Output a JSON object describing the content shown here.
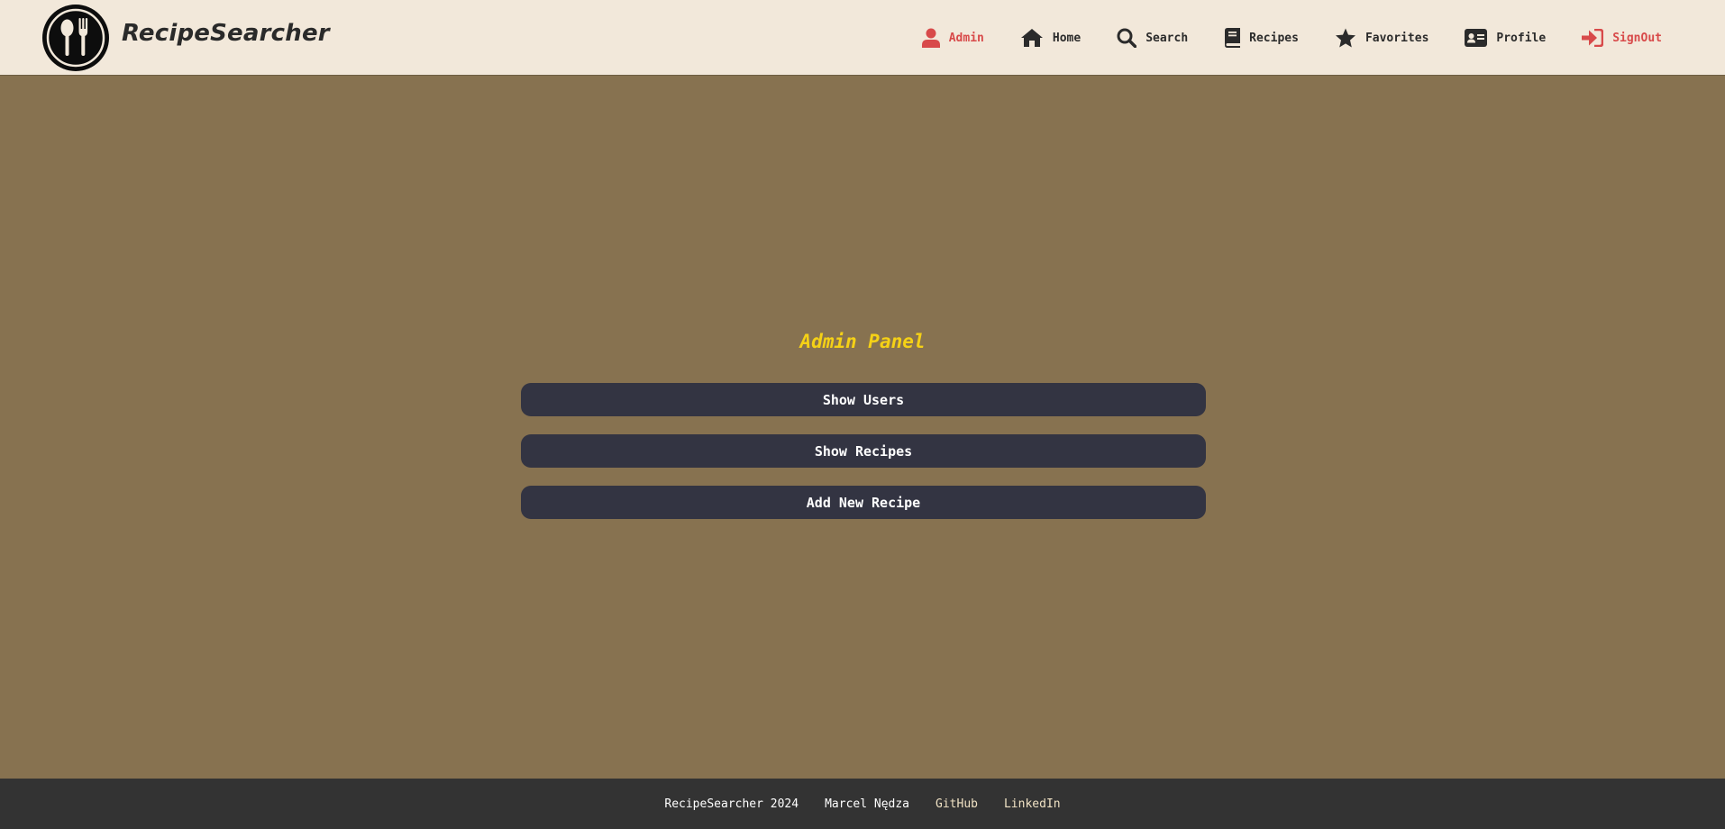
{
  "header": {
    "brand": "RecipeSearcher",
    "logo_icon": "spoon-fork-icon",
    "nav": [
      {
        "label": "Admin",
        "icon": "user-icon",
        "color": "#d84a4a"
      },
      {
        "label": "Home",
        "icon": "home-icon",
        "color": "#2b2b2b"
      },
      {
        "label": "Search",
        "icon": "search-icon",
        "color": "#2b2b2b"
      },
      {
        "label": "Recipes",
        "icon": "book-icon",
        "color": "#2b2b2b"
      },
      {
        "label": "Favorites",
        "icon": "star-icon",
        "color": "#2b2b2b"
      },
      {
        "label": "Profile",
        "icon": "id-card-icon",
        "color": "#2b2b2b"
      },
      {
        "label": "SignOut",
        "icon": "sign-out-icon",
        "color": "#d84a4a"
      }
    ]
  },
  "main": {
    "title": "Admin Panel",
    "buttons": [
      {
        "label": "Show Users"
      },
      {
        "label": "Show Recipes"
      },
      {
        "label": "Add New Recipe"
      }
    ]
  },
  "footer": {
    "copyright": "RecipeSearcher 2024",
    "author": "Marcel Nędza",
    "github": "GitHub",
    "linkedin": "LinkedIn"
  },
  "colors": {
    "page_bg": "#877250",
    "header_bg": "#f2e8da",
    "accent_title": "#f5d116",
    "button_bg": "#333442",
    "footer_bg": "#333333",
    "danger": "#d84a4a"
  }
}
